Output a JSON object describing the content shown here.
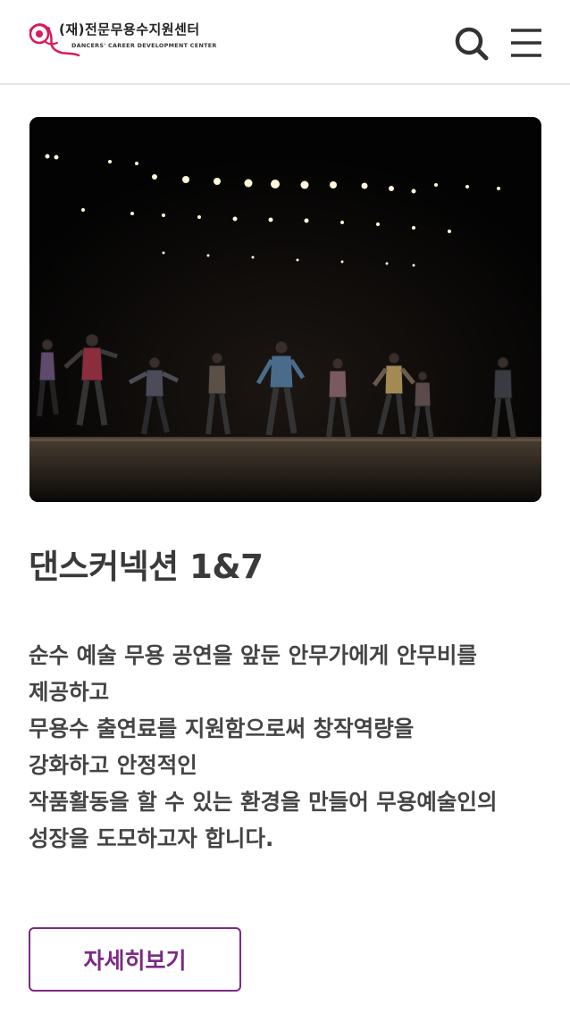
{
  "header": {
    "logo_kr": "(재)전문무용수지원센터",
    "logo_en": "DANCERS' CAREER DEVELOPMENT CENTER",
    "search_icon": "search-icon",
    "menu_icon": "hamburger-menu-icon",
    "brand_color": "#d81b5a"
  },
  "main": {
    "image_icon": "stage-dance-photo",
    "title": "댄스커넥션 1&7",
    "description": [
      "순수 예술 무용 공연을 앞둔 안무가에게 안무비를",
      "제공하고",
      "무용수 출연료를 지원함으로써 창작역량을",
      "강화하고 안정적인",
      "작품활동을 할 수 있는 환경을 만들어 무용예술인의",
      "성장을 도모하고자 합니다."
    ],
    "more_button": "자세히보기",
    "accent_color": "#7b2a83"
  }
}
